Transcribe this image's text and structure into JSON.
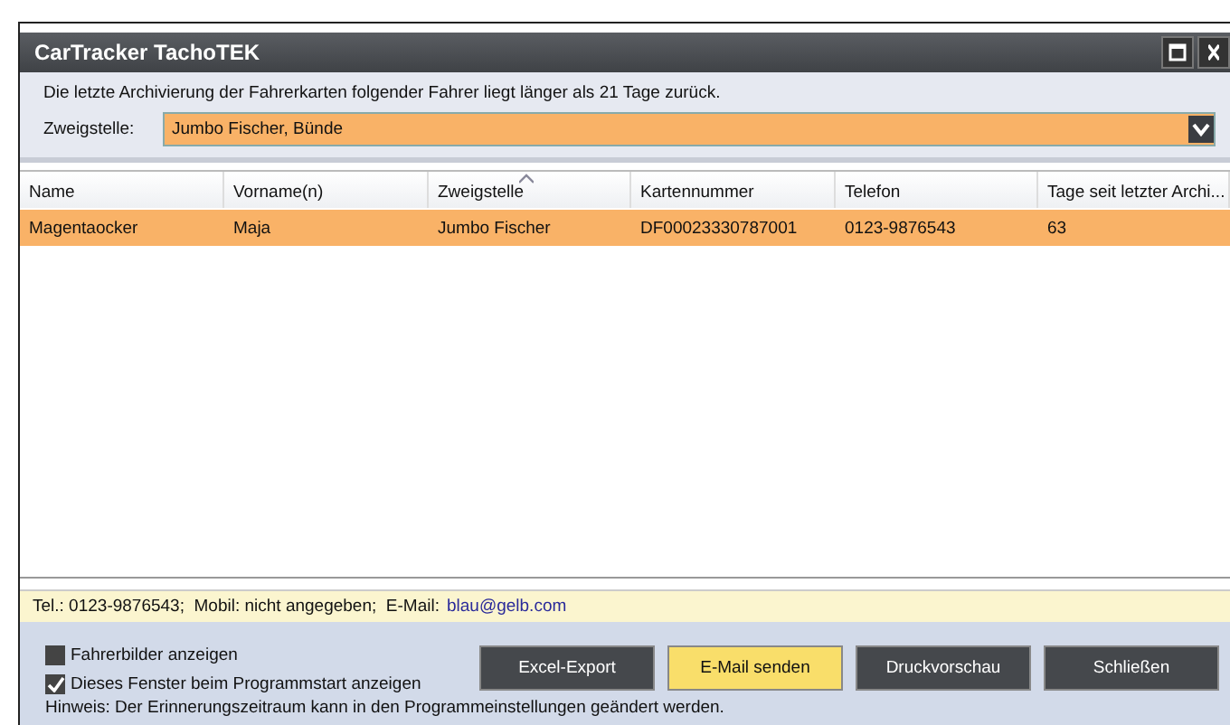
{
  "window": {
    "title": "CarTracker TachoTEK"
  },
  "message": "Die letzte Archivierung der Fahrerkarten folgender Fahrer liegt länger als 21 Tage zurück.",
  "branch": {
    "label": "Zweigstelle:",
    "value": "Jumbo Fischer, Bünde"
  },
  "table": {
    "columns": [
      {
        "label": "Name",
        "sorted": false
      },
      {
        "label": "Vorname(n)",
        "sorted": false
      },
      {
        "label": "Zweigstelle",
        "sorted": true
      },
      {
        "label": "Kartennummer",
        "sorted": false
      },
      {
        "label": "Telefon",
        "sorted": false
      },
      {
        "label": "Tage seit letzter Archi...",
        "sorted": false
      }
    ],
    "rows": [
      {
        "selected": true,
        "cells": [
          "Magentaocker",
          "Maja",
          "Jumbo Fischer",
          "DF00023330787001",
          "0123-9876543",
          "63"
        ]
      }
    ]
  },
  "contact": {
    "text": "Tel.: 0123-9876543;  Mobil: nicht angegeben;  E-Mail:",
    "email": "blau@gelb.com"
  },
  "options": [
    {
      "label": "Fahrerbilder anzeigen",
      "checked": false
    },
    {
      "label": "Dieses Fenster beim Programmstart anzeigen",
      "checked": true
    }
  ],
  "buttons": [
    {
      "label": "Excel-Export",
      "default": false
    },
    {
      "label": "E-Mail senden",
      "default": true
    },
    {
      "label": "Druckvorschau",
      "default": false
    },
    {
      "label": "Schließen",
      "default": false
    }
  ],
  "hint": "Hinweis: Der Erinnerungszeitraum kann in den Programmeinstellungen geändert werden."
}
